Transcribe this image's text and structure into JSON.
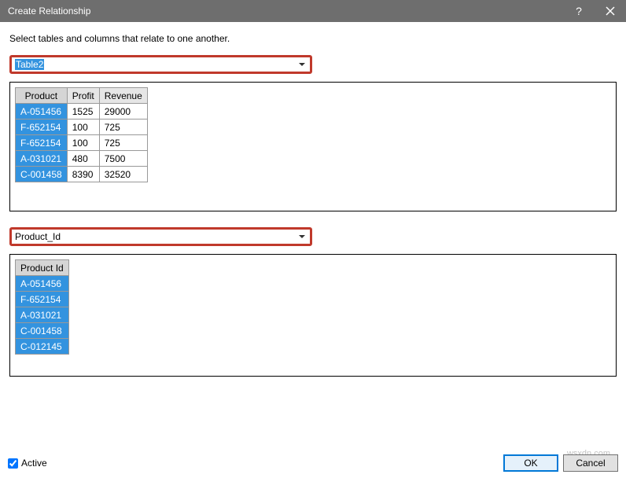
{
  "titlebar": {
    "title": "Create Relationship",
    "help_label": "?"
  },
  "instruction": "Select tables and columns that relate to one another.",
  "dropdown1": {
    "value": "Table2"
  },
  "table1": {
    "headers": [
      "Product",
      "Profit",
      "Revenue"
    ],
    "rows": [
      [
        "A-051456",
        "1525",
        "29000"
      ],
      [
        "F-652154",
        "100",
        "725"
      ],
      [
        "F-652154",
        "100",
        "725"
      ],
      [
        "A-031021",
        "480",
        "7500"
      ],
      [
        "C-001458",
        "8390",
        "32520"
      ]
    ],
    "selected_col": 0
  },
  "dropdown2": {
    "value": "Product_Id"
  },
  "table2": {
    "headers": [
      "Product Id"
    ],
    "rows": [
      [
        "A-051456"
      ],
      [
        "F-652154"
      ],
      [
        "A-031021"
      ],
      [
        "C-001458"
      ],
      [
        "C-012145"
      ]
    ],
    "selected_col": 0
  },
  "footer": {
    "active_label": "Active",
    "active_checked": true,
    "ok_label": "OK",
    "cancel_label": "Cancel"
  },
  "watermark": "wsxdn.com"
}
